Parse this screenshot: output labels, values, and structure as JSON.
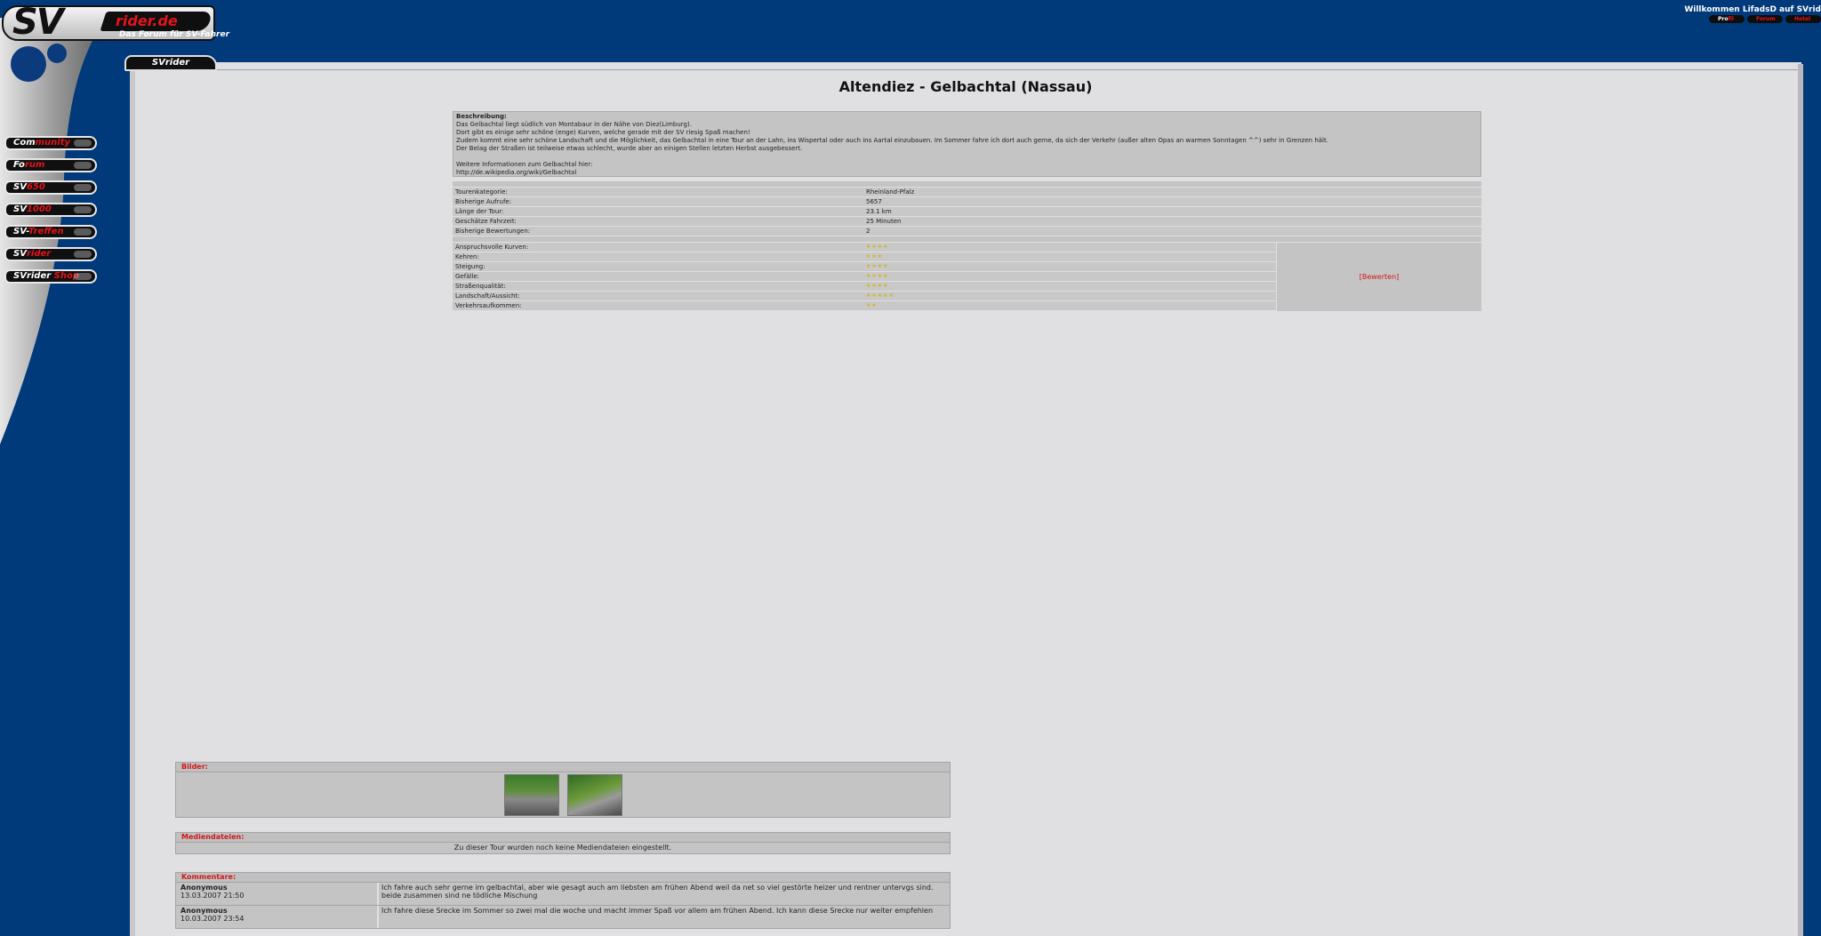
{
  "header": {
    "logo_sv": "SV",
    "logo_rider": "rider.de",
    "tagline": "Das Forum für SV-Fahrer",
    "welcome": "Willkommen LifadsD auf SVrid",
    "topnav": [
      {
        "a": "Pro",
        "b": "fil"
      },
      {
        "a": "",
        "b": "Forum"
      },
      {
        "a": "",
        "b": "Hotel"
      }
    ]
  },
  "sidenav": {
    "items": [
      {
        "a": "Com",
        "b": "munity"
      },
      {
        "a": "Fo",
        "b": "rum"
      },
      {
        "a": "SV",
        "b": "650"
      },
      {
        "a": "SV",
        "b": "1000"
      },
      {
        "a": "SV-",
        "b": "Treffen"
      },
      {
        "a": "SV",
        "b": "rider"
      },
      {
        "a": "SVrider ",
        "b": "Shop"
      }
    ]
  },
  "tab": "SVrider",
  "page_title": "Altendiez - Gelbachtal (Nassau)",
  "description": {
    "heading": "Beschreibung:",
    "lines": [
      "Das Gelbachtal liegt südlich von Montabaur in der Nähe von Diez(Limburg).",
      "Dort gibt es einige sehr schöne (enge) Kurven, welche gerade mit der SV riesig Spaß machen!",
      "Zudem kommt eine sehr schöne Landschaft und die Möglichkeit, das Gelbachtal in eine Tour an der Lahn, ins Wispertal oder auch ins Aartal einzubauen. Im Sommer fahre ich dort auch gerne, da sich der Verkehr (außer alten Opas an warmen Sonntagen ^^) sehr in Grenzen hält.",
      "Der Belag der Straßen ist teilweise etwas schlecht, wurde aber an einigen Stellen letzten Herbst ausgebessert.",
      "",
      "Weitere Informationen zum Gelbachtal hier:",
      "http://de.wikipedia.org/wiki/Gelbachtal"
    ]
  },
  "details": [
    {
      "label": "Tourenkategorie:",
      "value": "Rheinland-Pfalz"
    },
    {
      "label": "Bisherige Aufrufe:",
      "value": "5657"
    },
    {
      "label": "Länge der Tour:",
      "value": "23.1 km"
    },
    {
      "label": "Geschätze Fahrzeit:",
      "value": "25 Minuten"
    },
    {
      "label": "Bisherige Bewertungen:",
      "value": "2"
    }
  ],
  "ratings": [
    {
      "label": "Anspruchsvolle Kurven:",
      "stars": "★★★★",
      "value": 4
    },
    {
      "label": "Kehren:",
      "stars": "★★★",
      "value": 3
    },
    {
      "label": "Steigung:",
      "stars": "★★★★",
      "value": 4
    },
    {
      "label": "Gefälle:",
      "stars": "★★★★",
      "value": 4
    },
    {
      "label": "Straßenqualität:",
      "stars": "★★★★",
      "value": 4
    },
    {
      "label": "Landschaft/Aussicht:",
      "stars": "★★★★★",
      "value": 5
    },
    {
      "label": "Verkehrsaufkommen:",
      "stars": "★★",
      "value": 2
    }
  ],
  "rate_link": "[Bewerten]",
  "bilder": {
    "heading": "Bilder:"
  },
  "media": {
    "heading": "Mediendateien:",
    "empty_text": "Zu dieser Tour wurden noch keine Mediendateien eingestellt."
  },
  "comments": {
    "heading": "Kommentare:",
    "items": [
      {
        "author": "Anonymous",
        "date": "13.03.2007 21:50",
        "text": "Ich fahre auch sehr gerne im gelbachtal, aber wie gesagt auch am liebsten am frühen Abend weil da net so viel gestörte heizer und rentner untervgs sind. beide zusammen sind ne tödliche Mischung"
      },
      {
        "author": "Anonymous",
        "date": "10.03.2007 23:54",
        "text": "Ich fahre diese Srecke im Sommer so zwei mal die woche und macht immer Spaß vor allem am frühen Abend. Ich kann diese Srecke nur weiter empfehlen"
      }
    ]
  },
  "colors": {
    "background": "#003a7a",
    "panel": "#e0e0e2",
    "accent_red": "#e3151a",
    "star": "#d8b41a"
  }
}
